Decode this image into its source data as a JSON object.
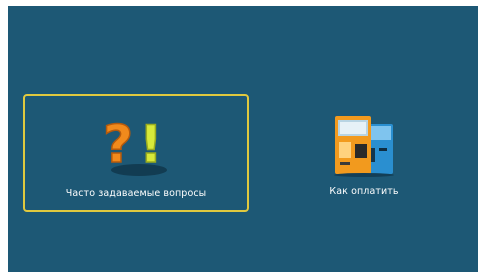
{
  "tiles": [
    {
      "label": "Часто задаваемые вопросы",
      "icon": "faq-question-exclamation-icon",
      "selected": true
    },
    {
      "label": "Как оплатить",
      "icon": "payment-terminal-icon",
      "selected": false
    }
  ],
  "colors": {
    "background": "#1d5875",
    "selection_border": "#e0c93f",
    "question_mark": "#f18a1c",
    "exclamation_mark": "#d7e93a",
    "text": "#ffffff"
  }
}
